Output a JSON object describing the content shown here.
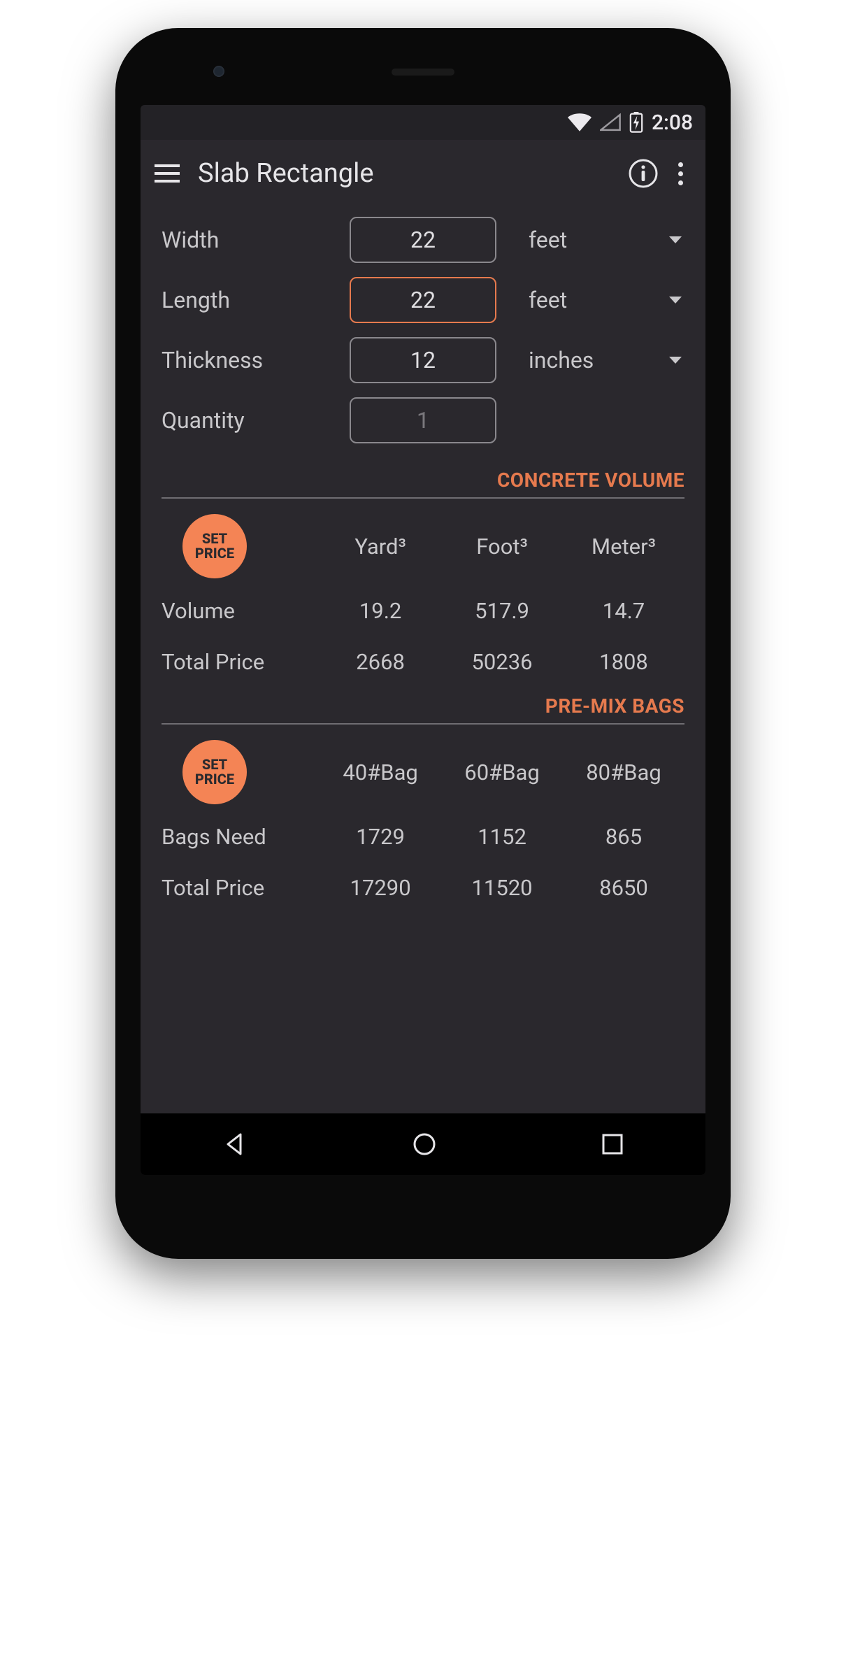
{
  "status": {
    "time": "2:08"
  },
  "header": {
    "title": "Slab Rectangle"
  },
  "inputs": {
    "width": {
      "label": "Width",
      "value": "22",
      "unit": "feet"
    },
    "length": {
      "label": "Length",
      "value": "22",
      "unit": "feet"
    },
    "thickness": {
      "label": "Thickness",
      "value": "12",
      "unit": "inches"
    },
    "quantity": {
      "label": "Quantity",
      "value": "1"
    }
  },
  "sections": {
    "volume": {
      "title": "CONCRETE VOLUME",
      "set_price_label_1": "SET",
      "set_price_label_2": "PRICE",
      "cols": {
        "c1": "Yard³",
        "c2": "Foot³",
        "c3": "Meter³"
      },
      "rows": {
        "volume": {
          "label": "Volume",
          "c1": "19.2",
          "c2": "517.9",
          "c3": "14.7"
        },
        "total_price": {
          "label": "Total Price",
          "c1": "2668",
          "c2": "50236",
          "c3": "1808"
        }
      }
    },
    "bags": {
      "title": "PRE-MIX BAGS",
      "set_price_label_1": "SET",
      "set_price_label_2": "PRICE",
      "cols": {
        "c1": "40#Bag",
        "c2": "60#Bag",
        "c3": "80#Bag"
      },
      "rows": {
        "bags_need": {
          "label": "Bags Need",
          "c1": "1729",
          "c2": "1152",
          "c3": "865"
        },
        "total_price": {
          "label": "Total Price",
          "c1": "17290",
          "c2": "11520",
          "c3": "8650"
        }
      }
    }
  }
}
